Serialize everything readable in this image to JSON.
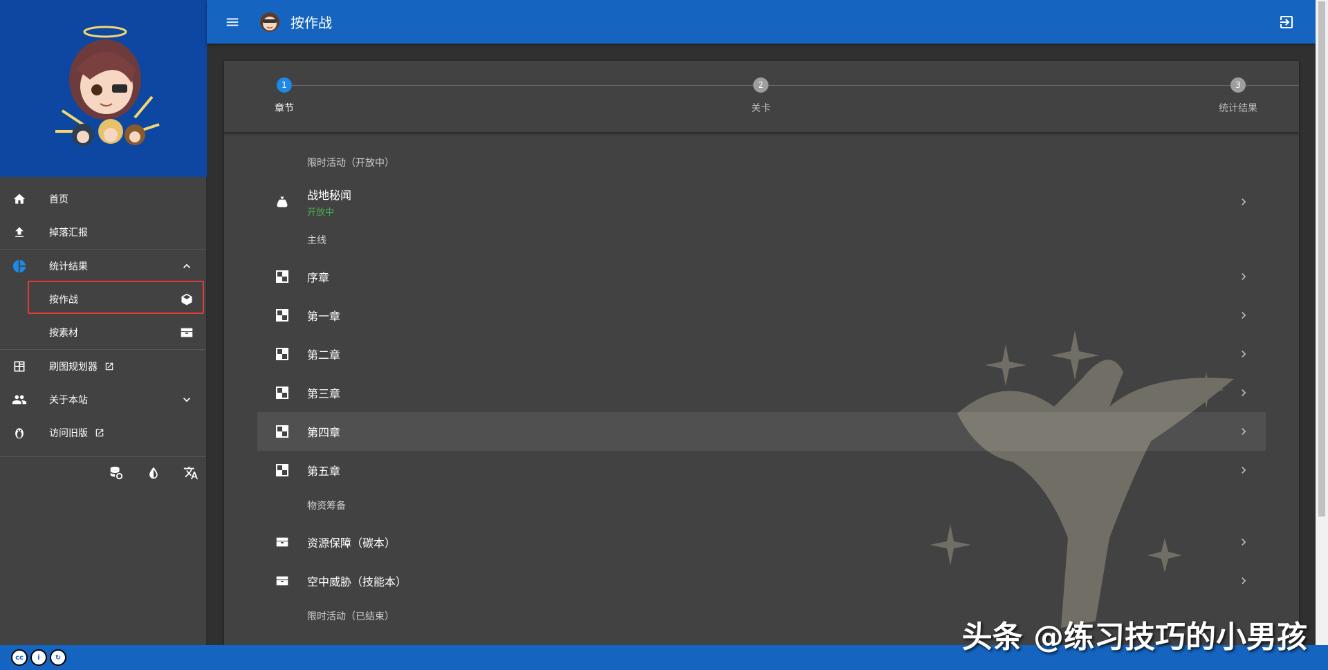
{
  "app": {
    "title": "按作战"
  },
  "sidebar": {
    "items": [
      {
        "label": "首页",
        "icon": "home-icon"
      },
      {
        "label": "掉落汇报",
        "icon": "upload-icon"
      },
      {
        "label": "统计结果",
        "icon": "pie-chart-icon",
        "expanded": true
      },
      {
        "label": "按作战",
        "icon": "cube-icon",
        "sub": true
      },
      {
        "label": "按素材",
        "icon": "chest-icon",
        "sub": true
      },
      {
        "label": "刷图规划器",
        "icon": "planner-icon",
        "external": true
      },
      {
        "label": "关于本站",
        "icon": "people-icon",
        "expandable": true
      },
      {
        "label": "访问旧版",
        "icon": "penguin-icon",
        "external": true
      }
    ]
  },
  "stepper": {
    "steps": [
      {
        "num": "1",
        "label": "章节",
        "active": true
      },
      {
        "num": "2",
        "label": "关卡",
        "active": false
      },
      {
        "num": "3",
        "label": "统计结果",
        "active": false
      }
    ]
  },
  "list": {
    "sections": [
      {
        "header": "限时活动（开放中）",
        "rows": [
          {
            "name": "战地秘闻",
            "status": "开放中",
            "icon": "bag-icon"
          }
        ]
      },
      {
        "header": "主线",
        "rows": [
          {
            "name": "序章",
            "icon": "chapter-icon"
          },
          {
            "name": "第一章",
            "icon": "chapter-icon"
          },
          {
            "name": "第二章",
            "icon": "chapter-icon"
          },
          {
            "name": "第三章",
            "icon": "chapter-icon"
          },
          {
            "name": "第四章",
            "icon": "chapter-icon",
            "active": true
          },
          {
            "name": "第五章",
            "icon": "chapter-icon"
          }
        ]
      },
      {
        "header": "物资筹备",
        "rows": [
          {
            "name": "资源保障（碳本）",
            "icon": "chest-icon"
          },
          {
            "name": "空中威胁（技能本）",
            "icon": "chest-icon"
          }
        ]
      },
      {
        "header": "限时活动（已结束）",
        "rows": []
      }
    ]
  },
  "watermark": "头条 @练习技巧的小男孩",
  "colors": {
    "primary": "#1565c0",
    "sidebar_header": "#0d47a1",
    "open_status": "#4caf50",
    "highlight": "#e53935"
  }
}
